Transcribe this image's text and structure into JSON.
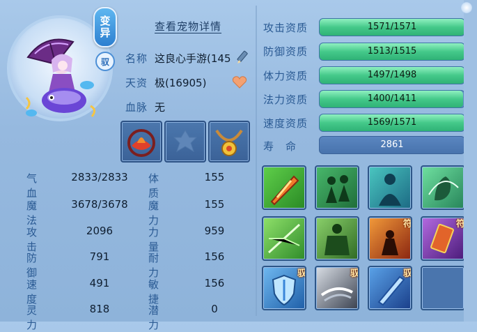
{
  "pet": {
    "variant_badge": [
      "变",
      "异"
    ],
    "yu_badge": "驭",
    "detail_link": "查看宠物详情",
    "name_label": "名称",
    "name_value": "这良心手游(145",
    "talent_label": "天资",
    "talent_value": "极(16905)",
    "blood_label": "血脉",
    "blood_value": "无"
  },
  "equipment": [
    {
      "name": "crown-equip-icon"
    },
    {
      "name": "empty-equip-slot"
    },
    {
      "name": "amulet-equip-icon"
    }
  ],
  "stats": [
    {
      "label": "气血",
      "value": "2833/2833",
      "label2": "体质",
      "value2": "155"
    },
    {
      "label": "魔法",
      "value": "3678/3678",
      "label2": "魔力",
      "value2": "155"
    },
    {
      "label": "攻击",
      "value": "2096",
      "label2": "力量",
      "value2": "959"
    },
    {
      "label": "防御",
      "value": "791",
      "label2": "耐力",
      "value2": "156"
    },
    {
      "label": "速度",
      "value": "491",
      "label2": "敏捷",
      "value2": "156"
    },
    {
      "label": "灵力",
      "value": "818",
      "label2": "潜力",
      "value2": "0"
    }
  ],
  "aptitudes": [
    {
      "label": "攻击资质",
      "text": "1571/1571",
      "fill": 1.0
    },
    {
      "label": "防御资质",
      "text": "1513/1515",
      "fill": 0.999
    },
    {
      "label": "体力资质",
      "text": "1497/1498",
      "fill": 0.999
    },
    {
      "label": "法力资质",
      "text": "1400/1411",
      "fill": 0.992
    },
    {
      "label": "速度资质",
      "text": "1569/1571",
      "fill": 0.999
    }
  ],
  "lifespan": {
    "label": "寿　命",
    "value": "2861"
  },
  "skills": [
    {
      "name": "sword-strike-skill-icon",
      "tag": ""
    },
    {
      "name": "shadow-fighters-skill-icon",
      "tag": ""
    },
    {
      "name": "water-figure-skill-icon",
      "tag": ""
    },
    {
      "name": "green-claw-skill-icon",
      "tag": ""
    },
    {
      "name": "green-burst-skill-icon",
      "tag": ""
    },
    {
      "name": "ogre-strength-skill-icon",
      "tag": ""
    },
    {
      "name": "warrior-fire-skill-icon",
      "tag": "符"
    },
    {
      "name": "talisman-scroll-skill-icon",
      "tag": "符"
    },
    {
      "name": "shield-skill-icon",
      "tag": "驭"
    },
    {
      "name": "dash-skill-icon",
      "tag": "驭"
    },
    {
      "name": "blade-skill-icon",
      "tag": "驭"
    },
    {
      "name": "empty-skill-slot",
      "tag": ""
    }
  ]
}
